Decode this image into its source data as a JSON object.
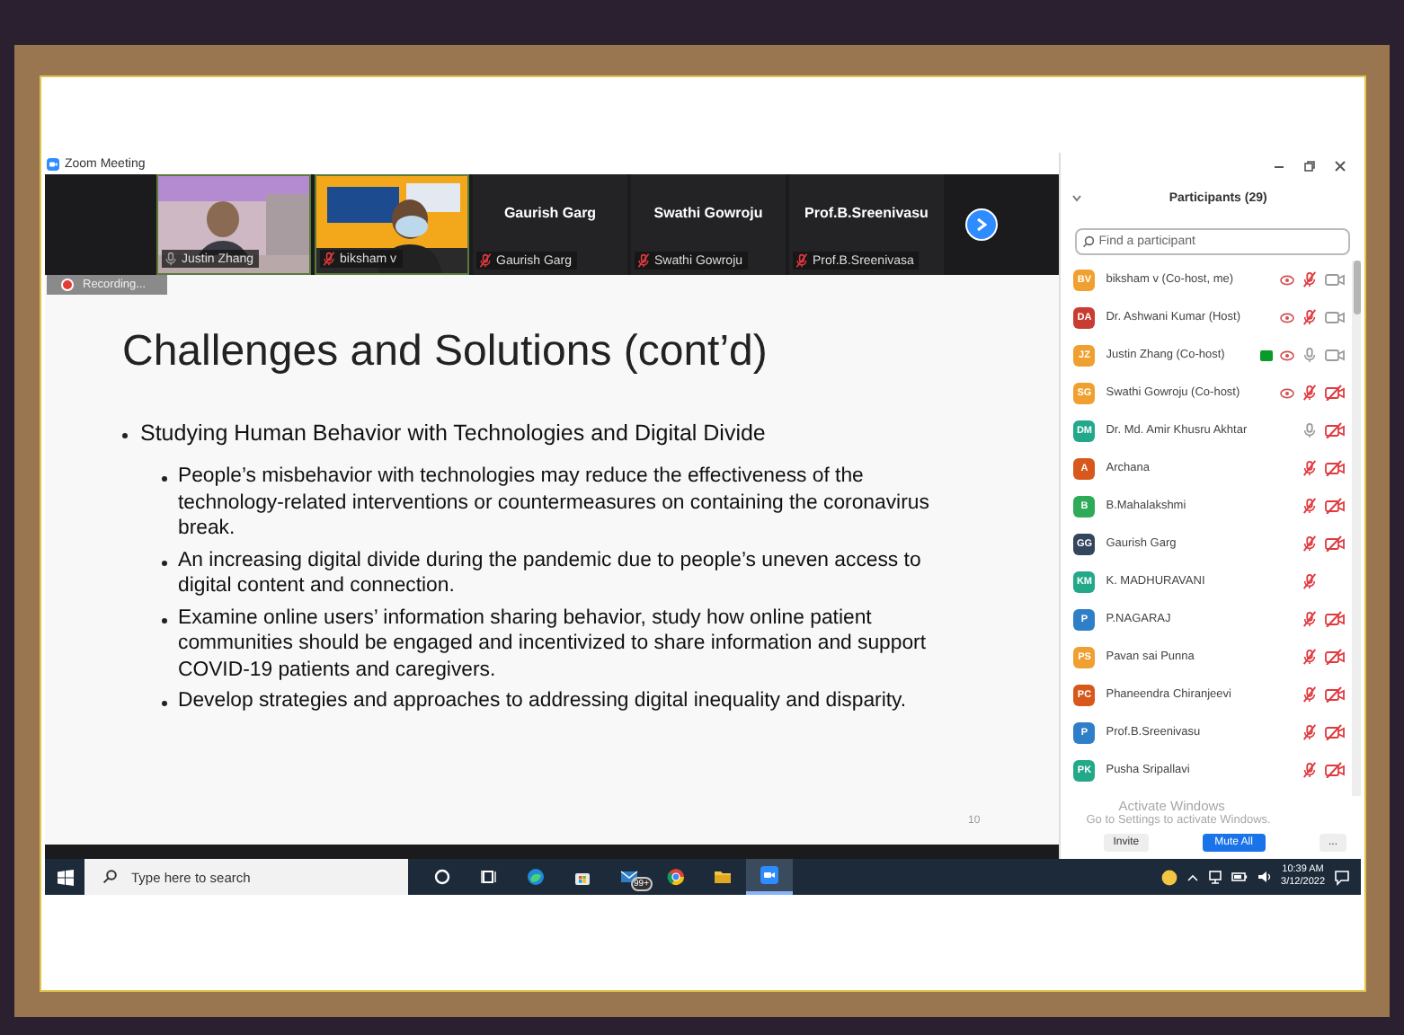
{
  "window": {
    "title": "Zoom Meeting"
  },
  "video_strip": {
    "tiles": [
      {
        "kind": "video",
        "name": "Justin Zhang",
        "muted": false
      },
      {
        "kind": "video",
        "name": "biksham v",
        "muted": true
      },
      {
        "kind": "name",
        "title": "Gaurish Garg",
        "name": "Gaurish Garg",
        "muted": true
      },
      {
        "kind": "name",
        "title": "Swathi Gowroju",
        "name": "Swathi Gowroju",
        "muted": true
      },
      {
        "kind": "name",
        "title": "Prof.B.Sreenivasu",
        "name": "Prof.B.Sreenivasa",
        "muted": true
      }
    ]
  },
  "recording": {
    "label": "Recording..."
  },
  "slide": {
    "title": "Challenges and Solutions (cont’d)",
    "bullets": [
      {
        "text": "Studying Human Behavior with Technologies and Digital Divide",
        "children": [
          {
            "text": "People’s misbehavior with technologies may reduce the effectiveness of the technology-related interventions or countermeasures on containing the coronavirus break."
          },
          {
            "text": "An increasing digital divide during the pandemic due to people’s uneven access to digital content and connection."
          },
          {
            "text": "Examine online users’ information sharing behavior, study how online patient communities should be engaged and incentivized to share information and support COVID-19 patients and caregivers."
          },
          {
            "text": "Develop strategies and approaches to addressing digital inequality and disparity."
          }
        ]
      }
    ],
    "page_number": "10"
  },
  "participants": {
    "title": "Participants (29)",
    "search": {
      "placeholder": "Find a participant"
    },
    "items": [
      {
        "initials": "BV",
        "color": "#f0a030",
        "name": "biksham v (Co-host, me)",
        "flag": false,
        "eye": true,
        "muted": true,
        "camera_off": false
      },
      {
        "initials": "DA",
        "color": "#c83c32",
        "name": "Dr. Ashwani Kumar (Host)",
        "flag": false,
        "eye": true,
        "muted": true,
        "camera_off": false
      },
      {
        "initials": "JZ",
        "color": "#f0a030",
        "name": "Justin Zhang (Co-host)",
        "flag": true,
        "eye": true,
        "muted": false,
        "camera_off": false
      },
      {
        "initials": "SG",
        "color": "#f0a030",
        "name": "Swathi Gowroju (Co-host)",
        "flag": false,
        "eye": true,
        "muted": true,
        "camera_off": true
      },
      {
        "initials": "DM",
        "color": "#23a88a",
        "name": "Dr. Md. Amir Khusru Akhtar",
        "flag": false,
        "eye": false,
        "muted": false,
        "camera_off": true
      },
      {
        "initials": "A",
        "color": "#d8581c",
        "name": "Archana",
        "flag": false,
        "eye": false,
        "muted": true,
        "camera_off": true
      },
      {
        "initials": "B",
        "color": "#2eaa58",
        "name": "B.Mahalakshmi",
        "flag": false,
        "eye": false,
        "muted": true,
        "camera_off": true
      },
      {
        "initials": "GG",
        "color": "#34455e",
        "name": "Gaurish Garg",
        "flag": false,
        "eye": false,
        "muted": true,
        "camera_off": true
      },
      {
        "initials": "KM",
        "color": "#23a88a",
        "name": "K. MADHURAVANI",
        "flag": false,
        "eye": false,
        "muted": true
      },
      {
        "initials": "P",
        "color": "#2f7fc8",
        "name": "P.NAGARAJ",
        "flag": false,
        "eye": false,
        "muted": true,
        "camera_off": true
      },
      {
        "initials": "PS",
        "color": "#f0a030",
        "name": "Pavan sai Punna",
        "flag": false,
        "eye": false,
        "muted": true,
        "camera_off": true
      },
      {
        "initials": "PC",
        "color": "#d8581c",
        "name": "Phaneendra Chiranjeevi",
        "flag": false,
        "eye": false,
        "muted": true,
        "camera_off": true
      },
      {
        "initials": "P",
        "color": "#2f7fc8",
        "name": "Prof.B.Sreenivasu",
        "flag": false,
        "eye": false,
        "muted": true,
        "camera_off": true
      },
      {
        "initials": "PK",
        "color": "#23a88a",
        "name": "Pusha Sripallavi",
        "flag": false,
        "eye": false,
        "muted": true,
        "camera_off": true
      }
    ],
    "buttons": [
      "Invite",
      "Mute All",
      "..."
    ]
  },
  "activation_notice": {
    "title": "Activate Windows",
    "text": "Go to Settings to activate Windows."
  },
  "taskbar": {
    "search": {
      "placeholder": "Type here to search"
    },
    "mail_badge": "99+",
    "time": "10:39 AM",
    "date": "3/12/2022"
  }
}
